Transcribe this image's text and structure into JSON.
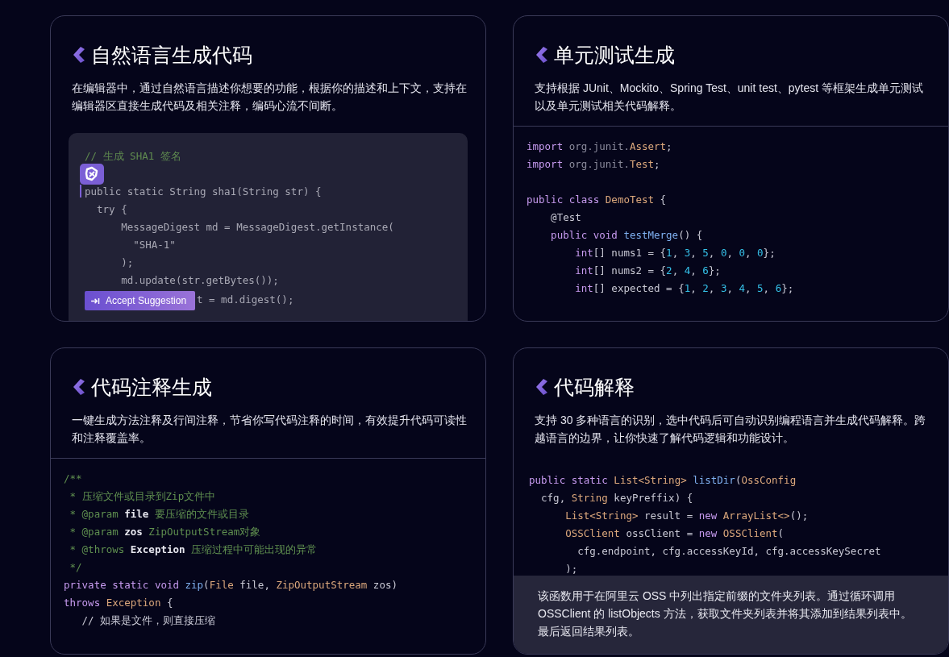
{
  "cards": [
    {
      "kind": "editor",
      "title": "自然语言生成代码",
      "description": "在编辑器中，通过自然语言描述你想要的功能，根据你的描述和上下文，支持在编辑器区直接生成代码及相关注释，编码心流不间断。",
      "lines": [
        {
          "kind": "code",
          "tokens": [
            {
              "text": "// 生成 SHA1 签名",
              "kind": "com"
            }
          ]
        },
        {
          "kind": "assistant"
        },
        {
          "kind": "cursor",
          "tokens": [
            {
              "text": "public static String sha1(String str) {",
              "kind": "plain"
            }
          ]
        },
        {
          "kind": "code",
          "tokens": [
            {
              "text": "  try {",
              "kind": "plain"
            }
          ]
        },
        {
          "kind": "code",
          "tokens": [
            {
              "text": "      MessageDigest md = MessageDigest.getInstance(",
              "kind": "plain"
            }
          ]
        },
        {
          "kind": "code",
          "tokens": [
            {
              "text": "        \"SHA-1\"",
              "kind": "plain"
            }
          ]
        },
        {
          "kind": "code",
          "tokens": [
            {
              "text": "      );",
              "kind": "plain"
            }
          ]
        },
        {
          "kind": "code",
          "tokens": [
            {
              "text": "      md.update(str.getBytes());",
              "kind": "plain"
            }
          ]
        },
        {
          "kind": "suggestion",
          "button": "Accept Suggestion",
          "tokens": [
            {
              "text": "t = md.digest();",
              "kind": "plain"
            }
          ]
        }
      ]
    },
    {
      "kind": "code",
      "title": "单元测试生成",
      "description": "支持根据 JUnit、Mockito、Spring Test、unit test、pytest 等框架生成单元测试以及单元测试相关代码解释。",
      "lines": [
        {
          "kind": "code",
          "tokens": [
            {
              "text": "import",
              "kind": "kw"
            },
            {
              "text": " org.junit.",
              "kind": "pkg"
            },
            {
              "text": "Assert",
              "kind": "type"
            },
            {
              "text": ";",
              "kind": "plain"
            }
          ]
        },
        {
          "kind": "code",
          "tokens": [
            {
              "text": "import",
              "kind": "kw"
            },
            {
              "text": " org.junit.",
              "kind": "pkg"
            },
            {
              "text": "Test",
              "kind": "type"
            },
            {
              "text": ";",
              "kind": "plain"
            }
          ]
        },
        {
          "kind": "blank"
        },
        {
          "kind": "code",
          "tokens": [
            {
              "text": "public class",
              "kind": "kw"
            },
            {
              "text": " DemoTest",
              "kind": "type"
            },
            {
              "text": " {",
              "kind": "plain"
            }
          ]
        },
        {
          "kind": "code",
          "tokens": [
            {
              "text": "    @Test",
              "kind": "plain"
            }
          ]
        },
        {
          "kind": "code",
          "tokens": [
            {
              "text": "    public void",
              "kind": "kw"
            },
            {
              "text": " testMerge",
              "kind": "fn"
            },
            {
              "text": "() {",
              "kind": "plain"
            }
          ]
        },
        {
          "kind": "code",
          "tokens": [
            {
              "text": "        int",
              "kind": "kw"
            },
            {
              "text": "[] nums1 = {",
              "kind": "plain"
            },
            {
              "text": "1",
              "kind": "num"
            },
            {
              "text": ", ",
              "kind": "plain"
            },
            {
              "text": "3",
              "kind": "num"
            },
            {
              "text": ", ",
              "kind": "plain"
            },
            {
              "text": "5",
              "kind": "num"
            },
            {
              "text": ", ",
              "kind": "plain"
            },
            {
              "text": "0",
              "kind": "num"
            },
            {
              "text": ", ",
              "kind": "plain"
            },
            {
              "text": "0",
              "kind": "num"
            },
            {
              "text": ", ",
              "kind": "plain"
            },
            {
              "text": "0",
              "kind": "num"
            },
            {
              "text": "};",
              "kind": "plain"
            }
          ]
        },
        {
          "kind": "code",
          "tokens": [
            {
              "text": "        int",
              "kind": "kw"
            },
            {
              "text": "[] nums2 = {",
              "kind": "plain"
            },
            {
              "text": "2",
              "kind": "num"
            },
            {
              "text": ", ",
              "kind": "plain"
            },
            {
              "text": "4",
              "kind": "num"
            },
            {
              "text": ", ",
              "kind": "plain"
            },
            {
              "text": "6",
              "kind": "num"
            },
            {
              "text": "};",
              "kind": "plain"
            }
          ]
        },
        {
          "kind": "code",
          "tokens": [
            {
              "text": "        int",
              "kind": "kw"
            },
            {
              "text": "[] expected = {",
              "kind": "plain"
            },
            {
              "text": "1",
              "kind": "num"
            },
            {
              "text": ", ",
              "kind": "plain"
            },
            {
              "text": "2",
              "kind": "num"
            },
            {
              "text": ", ",
              "kind": "plain"
            },
            {
              "text": "3",
              "kind": "num"
            },
            {
              "text": ", ",
              "kind": "plain"
            },
            {
              "text": "4",
              "kind": "num"
            },
            {
              "text": ", ",
              "kind": "plain"
            },
            {
              "text": "5",
              "kind": "num"
            },
            {
              "text": ", ",
              "kind": "plain"
            },
            {
              "text": "6",
              "kind": "num"
            },
            {
              "text": "};",
              "kind": "plain"
            }
          ]
        }
      ]
    },
    {
      "kind": "code",
      "title": "代码注释生成",
      "description": "一键生成方法注释及行间注释，节省你写代码注释的时间，有效提升代码可读性和注释覆盖率。",
      "lines": [
        {
          "kind": "code",
          "tokens": [
            {
              "text": "/**",
              "kind": "com"
            }
          ]
        },
        {
          "kind": "code",
          "tokens": [
            {
              "text": " * 压缩文件或目录到Zip文件中",
              "kind": "com"
            }
          ]
        },
        {
          "kind": "code",
          "tokens": [
            {
              "text": " * @param ",
              "kind": "com"
            },
            {
              "text": "file",
              "kind": "bold"
            },
            {
              "text": " 要压缩的文件或目录",
              "kind": "com"
            }
          ]
        },
        {
          "kind": "code",
          "tokens": [
            {
              "text": " * @param ",
              "kind": "com"
            },
            {
              "text": "zos",
              "kind": "bold"
            },
            {
              "text": " ZipOutputStream对象",
              "kind": "com"
            }
          ]
        },
        {
          "kind": "code",
          "tokens": [
            {
              "text": " * @throws ",
              "kind": "com"
            },
            {
              "text": "Exception",
              "kind": "bold"
            },
            {
              "text": " 压缩过程中可能出现的异常",
              "kind": "com"
            }
          ]
        },
        {
          "kind": "code",
          "tokens": [
            {
              "text": " */",
              "kind": "com"
            }
          ]
        },
        {
          "kind": "code",
          "tokens": [
            {
              "text": "private static void",
              "kind": "kw"
            },
            {
              "text": " zip",
              "kind": "fn"
            },
            {
              "text": "(",
              "kind": "plain"
            },
            {
              "text": "File",
              "kind": "type"
            },
            {
              "text": " file, ",
              "kind": "plain"
            },
            {
              "text": "ZipOutputStream",
              "kind": "type"
            },
            {
              "text": " zos)",
              "kind": "plain"
            }
          ]
        },
        {
          "kind": "code",
          "tokens": [
            {
              "text": "throws",
              "kind": "kw"
            },
            {
              "text": " Exception",
              "kind": "type"
            },
            {
              "text": " {",
              "kind": "plain"
            }
          ]
        },
        {
          "kind": "code",
          "tokens": [
            {
              "text": "   // 如果是文件，则直接压缩",
              "kind": "plain"
            }
          ]
        }
      ]
    },
    {
      "kind": "explain",
      "title": "代码解释",
      "description": "支持 30 多种语言的识别，选中代码后可自动识别编程语言并生成代码解释。跨越语言的边界，让你快速了解代码逻辑和功能设计。",
      "lines": [
        {
          "kind": "code",
          "tokens": [
            {
              "text": "public static",
              "kind": "kw"
            },
            {
              "text": " List<String>",
              "kind": "type"
            },
            {
              "text": " listDir",
              "kind": "fn"
            },
            {
              "text": "(",
              "kind": "plain"
            },
            {
              "text": "OssConfig",
              "kind": "type"
            }
          ]
        },
        {
          "kind": "code",
          "tokens": [
            {
              "text": "  cfg, ",
              "kind": "plain"
            },
            {
              "text": "String",
              "kind": "type"
            },
            {
              "text": " keyPreffix) {",
              "kind": "plain"
            }
          ]
        },
        {
          "kind": "code",
          "tokens": [
            {
              "text": "      List<String>",
              "kind": "type"
            },
            {
              "text": " result = ",
              "kind": "plain"
            },
            {
              "text": "new",
              "kind": "kw"
            },
            {
              "text": " ArrayList<>",
              "kind": "type"
            },
            {
              "text": "();",
              "kind": "plain"
            }
          ]
        },
        {
          "kind": "code",
          "tokens": [
            {
              "text": "      OSSClient",
              "kind": "type"
            },
            {
              "text": " ossClient = ",
              "kind": "plain"
            },
            {
              "text": "new",
              "kind": "kw"
            },
            {
              "text": " OSSClient",
              "kind": "type"
            },
            {
              "text": "(",
              "kind": "plain"
            }
          ]
        },
        {
          "kind": "code",
          "tokens": [
            {
              "text": "        cfg.endpoint, cfg.accessKeyId, cfg.accessKeySecret",
              "kind": "plain"
            }
          ]
        },
        {
          "kind": "code",
          "tokens": [
            {
              "text": "      );",
              "kind": "plain"
            }
          ]
        }
      ],
      "explanation": "该函数用于在阿里云 OSS 中列出指定前缀的文件夹列表。通过循环调用 OSSClient 的 listObjects 方法，获取文件夹列表并将其添加到结果列表中。最后返回结果列表。"
    }
  ]
}
